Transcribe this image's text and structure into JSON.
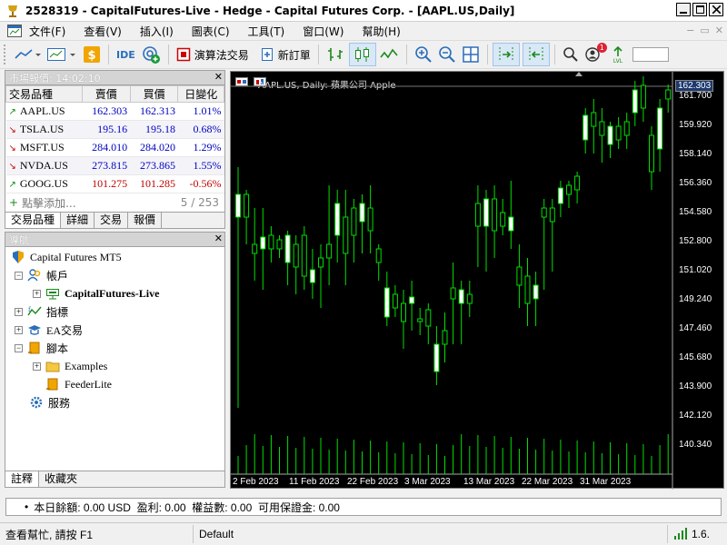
{
  "window": {
    "title": "2528319 - CapitalFutures-Live - Hedge - Capital Futures Corp. - [AAPL.US,Daily]"
  },
  "menu": {
    "items": [
      "文件(F)",
      "查看(V)",
      "插入(I)",
      "圖表(C)",
      "工具(T)",
      "窗口(W)",
      "幫助(H)"
    ]
  },
  "toolbar": {
    "algo_trading_label": "演算法交易",
    "new_order_label": "新訂單",
    "ide_label": "IDE",
    "notification_count": "1"
  },
  "market_watch": {
    "header": "市場報價: 14:02:10",
    "columns": [
      "交易品種",
      "賣價",
      "買價",
      "日變化"
    ],
    "rows": [
      {
        "symbol": "AAPL.US",
        "bid": "162.303",
        "ask": "162.313",
        "change": "1.01%",
        "direction": "up",
        "bid_color": "#0000c0",
        "ask_color": "#0000c0",
        "change_color": "#0000c0"
      },
      {
        "symbol": "TSLA.US",
        "bid": "195.16",
        "ask": "195.18",
        "change": "0.68%",
        "direction": "down",
        "bid_color": "#0000c0",
        "ask_color": "#0000c0",
        "change_color": "#0000c0"
      },
      {
        "symbol": "MSFT.US",
        "bid": "284.010",
        "ask": "284.020",
        "change": "1.29%",
        "direction": "down",
        "bid_color": "#0000c0",
        "ask_color": "#0000c0",
        "change_color": "#0000c0"
      },
      {
        "symbol": "NVDA.US",
        "bid": "273.815",
        "ask": "273.865",
        "change": "1.55%",
        "direction": "down",
        "bid_color": "#0000c0",
        "ask_color": "#0000c0",
        "change_color": "#0000c0"
      },
      {
        "symbol": "GOOG.US",
        "bid": "101.275",
        "ask": "101.285",
        "change": "-0.56%",
        "direction": "up",
        "bid_color": "#c00000",
        "ask_color": "#c00000",
        "change_color": "#c00000"
      }
    ],
    "add_label": "點擊添加...",
    "count": "5 / 253",
    "tabs": [
      "交易品種",
      "詳細",
      "交易",
      "報價"
    ]
  },
  "navigator": {
    "header": "導航",
    "root": "Capital Futures MT5",
    "accounts": "帳戶",
    "account_name": "CapitalFutures-Live",
    "indicators": "指標",
    "experts": "EA交易",
    "scripts": "腳本",
    "examples": "Examples",
    "feeder": "FeederLite",
    "services": "服務",
    "tabs": [
      "註釋",
      "收藏夾"
    ]
  },
  "chart": {
    "title": "AAPL.US, Daily: 蘋果公司 Apple",
    "current_price": "162.303",
    "price_labels": [
      "161.700",
      "159.920",
      "158.140",
      "156.360",
      "154.580",
      "152.800",
      "151.020",
      "149.240",
      "147.460",
      "145.680",
      "143.900",
      "142.120",
      "140.340"
    ],
    "date_labels": [
      "2 Feb 2023",
      "11 Feb 2023",
      "22 Feb 2023",
      "3 Mar 2023",
      "13 Mar 2023",
      "22 Mar 2023",
      "31 Mar 2023"
    ]
  },
  "account_bar": {
    "text": "本日餘額: 0.00 USD  盈利: 0.00  權益數: 0.00  可用保證金: 0.00"
  },
  "status_bar": {
    "help": "查看幫忙, 請按 F1",
    "profile": "Default",
    "ping": "1.6."
  }
}
